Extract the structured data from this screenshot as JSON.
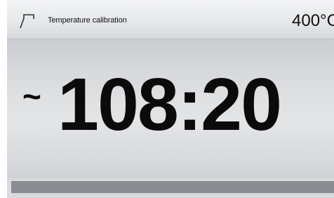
{
  "header": {
    "program_icon": "program-curve-icon",
    "program_name": "Temperature calibration",
    "temperature": "400°C"
  },
  "main": {
    "time_prefix": "~",
    "time_remaining": "108:20"
  },
  "progress": {
    "fraction": 0
  },
  "colors": {
    "header_bg": "#e6e8ea",
    "main_bg": "#dfe1e3",
    "text": "#0b0b0b",
    "progress_bar": "#8a8d91"
  }
}
